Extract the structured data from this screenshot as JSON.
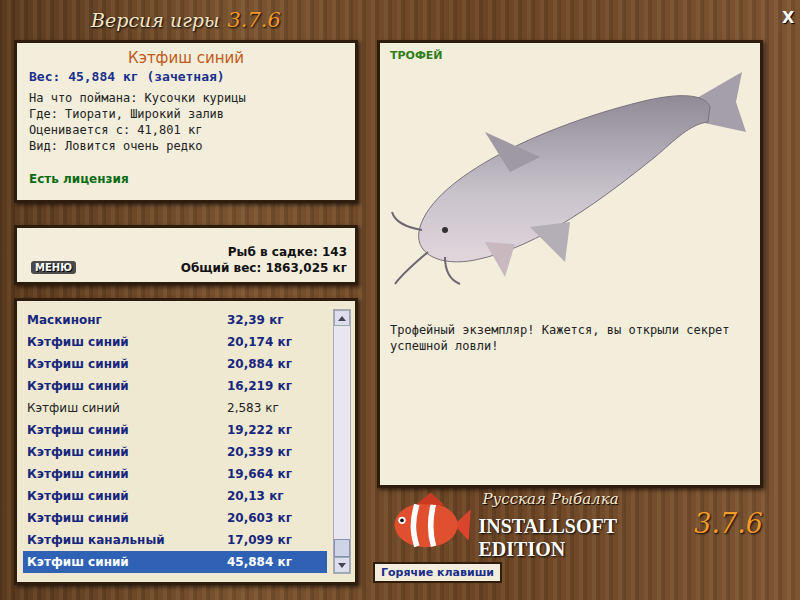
{
  "window": {
    "title": "Версия игры",
    "version": "3.7.6",
    "close": "X"
  },
  "catch": {
    "name": "Кэтфиш синий",
    "weight": "Вес: 45,884 кг (зачетная)",
    "fields": [
      "На что поймана: Кусочки курицы",
      "Где: Тиорати, Широкий залив",
      "Оценивается с: 41,801 кг",
      "Вид: Ловится очень редко"
    ],
    "license": "Есть лицензия"
  },
  "keepnet": {
    "menu_button": "МЕНЮ",
    "count": "Рыб в садке: 143",
    "total": "Общий вес: 1863,025 кг"
  },
  "list": {
    "rows": [
      {
        "name": "Маскинонг",
        "weight": "32,39 кг",
        "counted": true,
        "selected": false
      },
      {
        "name": "Кэтфиш синий",
        "weight": "20,174 кг",
        "counted": true,
        "selected": false
      },
      {
        "name": "Кэтфиш синий",
        "weight": "20,884 кг",
        "counted": true,
        "selected": false
      },
      {
        "name": "Кэтфиш синий",
        "weight": "16,219 кг",
        "counted": true,
        "selected": false
      },
      {
        "name": "Кэтфиш синий",
        "weight": "2,583 кг",
        "counted": false,
        "selected": false
      },
      {
        "name": "Кэтфиш синий",
        "weight": "19,222 кг",
        "counted": true,
        "selected": false
      },
      {
        "name": "Кэтфиш синий",
        "weight": "20,339 кг",
        "counted": true,
        "selected": false
      },
      {
        "name": "Кэтфиш синий",
        "weight": "19,664 кг",
        "counted": true,
        "selected": false
      },
      {
        "name": "Кэтфиш синий",
        "weight": "20,13 кг",
        "counted": true,
        "selected": false
      },
      {
        "name": "Кэтфиш синий",
        "weight": "20,603 кг",
        "counted": true,
        "selected": false
      },
      {
        "name": "Кэтфиш канальный",
        "weight": "17,099 кг",
        "counted": true,
        "selected": false
      },
      {
        "name": "Кэтфиш синий",
        "weight": "45,884 кг",
        "counted": true,
        "selected": true
      }
    ],
    "scroll": {
      "level": 1
    }
  },
  "trophy": {
    "badge": "ТРОФЕЙ",
    "message": "Трофейный экземпляр! Кажется, вы открыли секрет успешной ловли!"
  },
  "logo": {
    "title": "Русская Рыбалка",
    "edition": "INSTALLSOFT EDITION",
    "version": "3.7.6"
  },
  "hotkeys_button": "Горячие клавиши"
}
